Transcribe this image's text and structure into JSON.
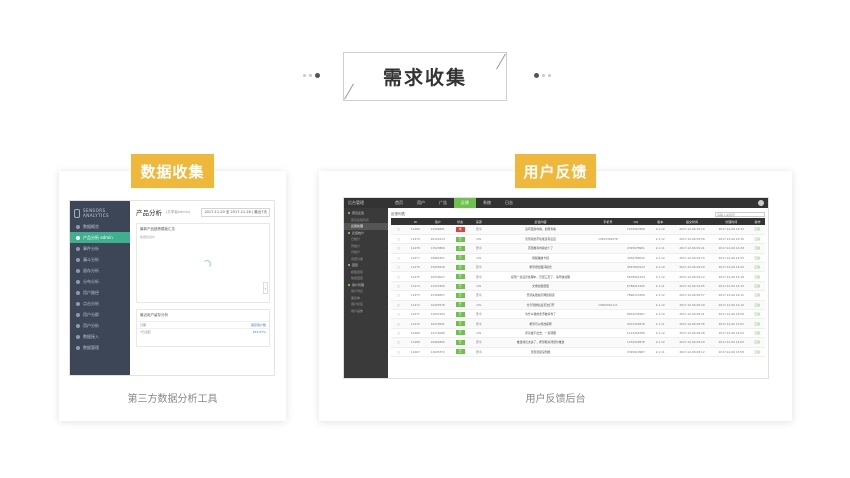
{
  "header": {
    "title": "需求收集"
  },
  "left_card": {
    "badge": "数据收集",
    "caption": "第三方数据分析工具",
    "screenshot": {
      "logo_text_1": "SENSORS",
      "logo_text_2": "ANALYTICS",
      "sidebar_items": [
        {
          "label": "数据概览",
          "active": false
        },
        {
          "label": "产品分析 admin",
          "active": true
        },
        {
          "label": "事件分析",
          "active": false
        },
        {
          "label": "漏斗分析",
          "active": false
        },
        {
          "label": "留存分析",
          "active": false
        },
        {
          "label": "分布分析",
          "active": false
        },
        {
          "label": "用户路径",
          "active": false
        },
        {
          "label": "点击分析",
          "active": false
        },
        {
          "label": "用户分群",
          "active": false
        },
        {
          "label": "用户分析",
          "active": false
        },
        {
          "label": "数据接入",
          "active": false
        },
        {
          "label": "数据管理",
          "active": false
        }
      ],
      "page_title": "产品分析",
      "page_subtitle": "(共享者admin)",
      "date_range": "2017-11-20 至 2017-11-26 | 最近7天",
      "panel_title": "最新产品趋势模板汇总",
      "panel_desc": "数据加载中",
      "panel2_title": "最近用户留存分析",
      "panel2_rows": [
        {
          "k": "日期",
          "v": "留存用户数"
        },
        {
          "k": "7日活跃",
          "v": "255.67%"
        }
      ]
    }
  },
  "right_card": {
    "badge": "用户反馈",
    "caption": "用户反馈后台",
    "screenshot": {
      "logo": "后台管理",
      "nav_items": [
        {
          "label": "首页",
          "active": false
        },
        {
          "label": "用户",
          "active": false
        },
        {
          "label": "广告",
          "active": false
        },
        {
          "label": "反馈",
          "active": true
        },
        {
          "label": "系统",
          "active": false
        },
        {
          "label": "日志",
          "active": false
        }
      ],
      "sidebar_items": [
        {
          "label": "意见反馈",
          "kind": "grp",
          "active": false
        },
        {
          "label": "意见反馈列表",
          "kind": "sub",
          "active": false
        },
        {
          "label": "反馈处理",
          "kind": "sub",
          "active": true
        },
        {
          "label": "反馈统计",
          "kind": "grp",
          "active": false
        },
        {
          "label": "日统计",
          "kind": "sub",
          "active": false
        },
        {
          "label": "周统计",
          "kind": "sub",
          "active": false
        },
        {
          "label": "月统计",
          "kind": "sub",
          "active": false
        },
        {
          "label": "问题分类",
          "kind": "sub",
          "active": false
        },
        {
          "label": "回复",
          "kind": "grp",
          "active": false
        },
        {
          "label": "模板回复",
          "kind": "sub",
          "active": false
        },
        {
          "label": "快捷回复",
          "kind": "sub",
          "active": false
        },
        {
          "label": "用户管理",
          "kind": "grp",
          "active": false
        },
        {
          "label": "用户列表",
          "kind": "sub",
          "active": false
        },
        {
          "label": "黑名单",
          "kind": "sub",
          "active": false
        },
        {
          "label": "用户标签",
          "kind": "sub",
          "active": false
        },
        {
          "label": "用户画像",
          "kind": "sub",
          "active": false
        }
      ],
      "list_title": "反馈列表",
      "search_placeholder": "请输入关键字",
      "columns": [
        "",
        "ID",
        "用户",
        "状态",
        "来源",
        "反馈内容",
        "手机号",
        "QQ",
        "版本",
        "提交时间",
        "处理时间",
        "操作"
      ],
      "rows": [
        {
          "id": "11480",
          "user": "12586891",
          "status": "red",
          "src": "安卓",
          "content": "没有更新内容，如何查看",
          "phone": "",
          "qq": "1234567890",
          "ver": "2.1.12",
          "t1": "2017-12-06 10:10",
          "t2": "2017-12-06 14:32",
          "op": "回复"
        },
        {
          "id": "11479",
          "user": "10152213",
          "status": "green",
          "src": "iOS",
          "content": "签到领金币功能没有反应",
          "phone": "13812345678",
          "qq": "",
          "ver": "2.1.12",
          "t1": "2017-12-06 09:58",
          "t2": "2017-12-06 14:30",
          "op": "回复"
        },
        {
          "id": "11478",
          "user": "11523869",
          "status": "green",
          "src": "安卓",
          "content": "首页推荐内容太少了",
          "phone": "",
          "qq": "2345678901",
          "ver": "2.1.11",
          "t1": "2017-12-06 09:41",
          "t2": "2017-12-06 14:28",
          "op": "回复"
        },
        {
          "id": "11477",
          "user": "10882351",
          "status": "green",
          "src": "iOS",
          "content": "视频播放卡顿",
          "phone": "",
          "qq": "3456789012",
          "ver": "2.1.12",
          "t1": "2017-12-06 09:33",
          "t2": "2017-12-06 14:25",
          "op": "回复"
        },
        {
          "id": "11476",
          "user": "12005618",
          "status": "green",
          "src": "安卓",
          "content": "希望增加夜间模式",
          "phone": "",
          "qq": "4567890123",
          "ver": "2.1.10",
          "t1": "2017-12-06 09:20",
          "t2": "2017-12-06 14:20",
          "op": "回复"
        },
        {
          "id": "11475",
          "user": "10559027",
          "status": "green",
          "src": "安卓",
          "content": "提现一直显示处理中，已经三天了，请尽快处理",
          "phone": "",
          "qq": "5678901234",
          "ver": "2.1.12",
          "t1": "2017-12-06 09:12",
          "t2": "2017-12-06 14:18",
          "op": "回复"
        },
        {
          "id": "11474",
          "user": "11257840",
          "status": "green",
          "src": "iOS",
          "content": "文章加载很慢",
          "phone": "",
          "qq": "6789012345",
          "ver": "2.1.11",
          "t1": "2017-12-06 09:05",
          "t2": "2017-12-06 14:15",
          "op": "回复"
        },
        {
          "id": "11473",
          "user": "12368457",
          "status": "green",
          "src": "安卓",
          "content": "登录失败提示网络错误",
          "phone": "",
          "qq": "7890123456",
          "ver": "2.1.12",
          "t1": "2017-12-06 08:57",
          "t2": "2017-12-06 14:12",
          "op": "回复"
        },
        {
          "id": "11472",
          "user": "10493576",
          "status": "green",
          "src": "iOS",
          "content": "分享到微信后无法打开",
          "phone": "13900001111",
          "qq": "",
          "ver": "2.1.12",
          "t1": "2017-12-06 08:49",
          "t2": "2017-12-06 14:10",
          "op": "回复"
        },
        {
          "id": "11471",
          "user": "11837204",
          "status": "green",
          "src": "安卓",
          "content": "为什么我的金币被清零了",
          "phone": "",
          "qq": "8901234567",
          "ver": "2.1.10",
          "t1": "2017-12-06 08:41",
          "t2": "2017-12-06 14:08",
          "op": "回复"
        },
        {
          "id": "11470",
          "user": "10276931",
          "status": "green",
          "src": "安卓",
          "content": "希望可以修改昵称",
          "phone": "",
          "qq": "9012345678",
          "ver": "2.1.11",
          "t1": "2017-12-06 08:36",
          "t2": "2017-12-06 14:05",
          "op": "回复"
        },
        {
          "id": "11469",
          "user": "12174089",
          "status": "green",
          "src": "iOS",
          "content": "评论发不出去，一直转圈",
          "phone": "",
          "qq": "1123456789",
          "ver": "2.1.12",
          "t1": "2017-12-06 08:28",
          "t2": "2017-12-06 14:02",
          "op": "回复"
        },
        {
          "id": "11468",
          "user": "10962845",
          "status": "green",
          "src": "安卓",
          "content": "推送消息太多了，希望能关闭部分推送",
          "phone": "",
          "qq": "1234509876",
          "ver": "2.1.12",
          "t1": "2017-12-06 08:20",
          "t2": "2017-12-06 14:00",
          "op": "回复"
        },
        {
          "id": "11467",
          "user": "11605372",
          "status": "green",
          "src": "安卓",
          "content": "签到奖励没到账",
          "phone": "",
          "qq": "2345610987",
          "ver": "2.1.11",
          "t1": "2017-12-06 08:12",
          "t2": "2017-12-06 13:58",
          "op": "回复"
        }
      ]
    }
  }
}
